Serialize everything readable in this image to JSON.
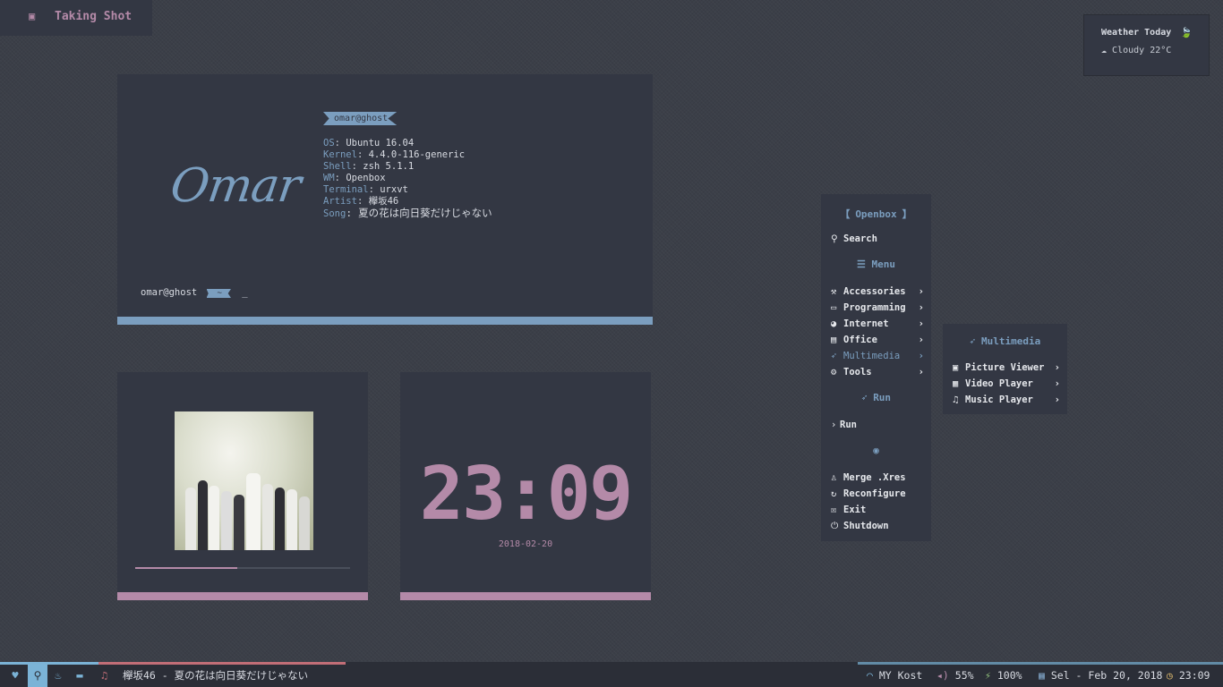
{
  "terminal": {
    "logo": "Omar",
    "header_tag": "omar@ghost",
    "info": [
      {
        "key": "OS",
        "value": "Ubuntu 16.04"
      },
      {
        "key": "Kernel",
        "value": "4.4.0-116-generic"
      },
      {
        "key": "Shell",
        "value": "zsh 5.1.1"
      },
      {
        "key": "WM",
        "value": "Openbox"
      },
      {
        "key": "Terminal",
        "value": "urxvt"
      },
      {
        "key": "Artist",
        "value": "欅坂46"
      },
      {
        "key": "Song",
        "value": "夏の花は向日葵だけじゃない"
      }
    ],
    "prompt_user": "omar@ghost",
    "prompt_dir": "~",
    "cursor": "_"
  },
  "music": {
    "progress": 0.475
  },
  "clock": {
    "time": "23:09",
    "date": "2018-02-20"
  },
  "weather": {
    "title": "Weather Today",
    "condition": "Cloudy 22°C",
    "title_icon": "leaf-icon",
    "condition_icon": "cloud-icon"
  },
  "menu": {
    "title": "Openbox",
    "search": "Search",
    "menu_header": "Menu",
    "items": [
      {
        "label": "Accessories",
        "icon": "wand-icon"
      },
      {
        "label": "Programming",
        "icon": "terminal-icon"
      },
      {
        "label": "Internet",
        "icon": "globe-icon"
      },
      {
        "label": "Office",
        "icon": "document-icon"
      },
      {
        "label": "Multimedia",
        "icon": "rocket-icon"
      },
      {
        "label": "Tools",
        "icon": "cogs-icon"
      }
    ],
    "run_header": "Run",
    "run_item": "Run",
    "system_items": [
      {
        "label": "Merge .Xres",
        "icon": "linux-icon"
      },
      {
        "label": "Reconfigure",
        "icon": "refresh-icon"
      },
      {
        "label": "Exit",
        "icon": "close-box-icon"
      },
      {
        "label": "Shutdown",
        "icon": "power-icon"
      }
    ]
  },
  "submenu": {
    "title": "Multimedia",
    "items": [
      {
        "label": "Picture Viewer",
        "icon": "picture-icon"
      },
      {
        "label": "Video Player",
        "icon": "film-icon"
      },
      {
        "label": "Music Player",
        "icon": "music-icon"
      }
    ]
  },
  "shot": {
    "label": "Taking Shot",
    "icon": "camera-icon"
  },
  "statusbar": {
    "now_playing": "欅坂46 - 夏の花は向日葵だけじゃない",
    "wifi": "MY Kost",
    "volume": "55%",
    "battery": "100%",
    "date": "Sel - Feb 20, 2018",
    "time": "23:09",
    "colors": {
      "blue": "#7bb3d6",
      "red": "#c26e77",
      "accent": "#7b9ebf",
      "pink": "#b48aa8"
    }
  }
}
